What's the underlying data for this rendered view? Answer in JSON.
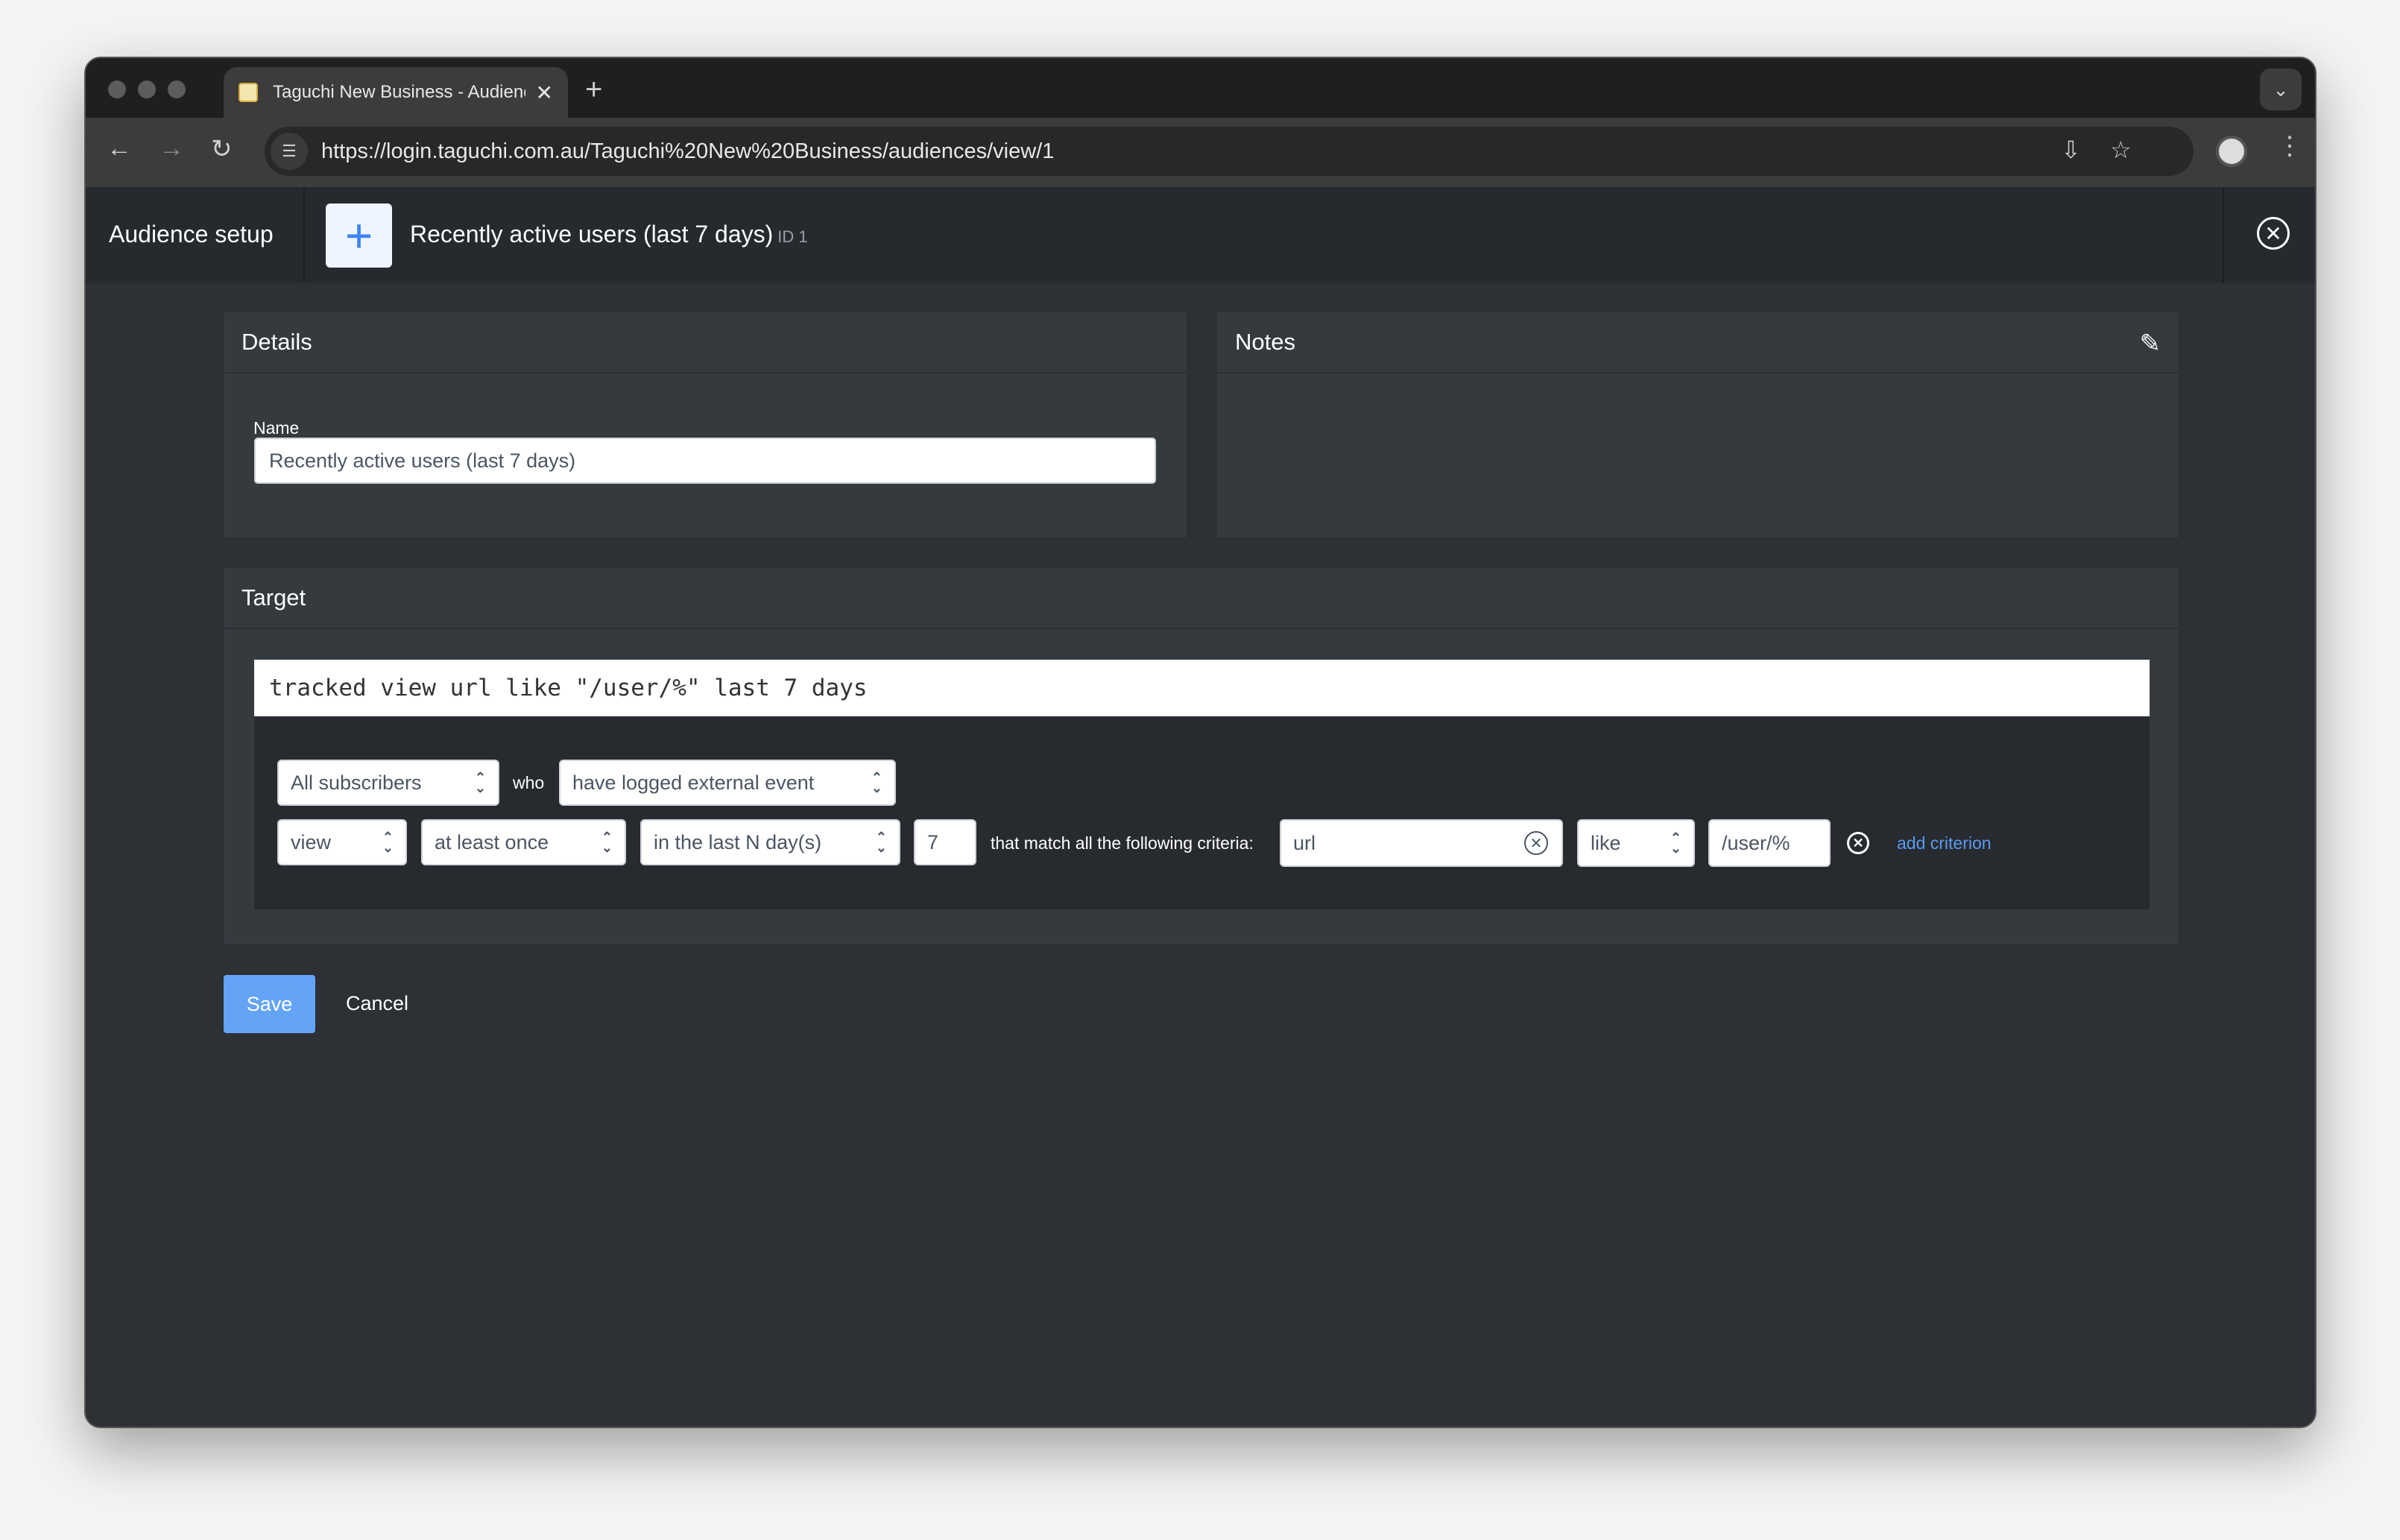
{
  "browser": {
    "tab_title": "Taguchi New Business - Audiences",
    "url": "https://login.taguchi.com.au/Taguchi%20New%20Business/audiences/view/1"
  },
  "header": {
    "section": "Audience setup",
    "title": "Recently active users (last 7 days)",
    "id_label": "ID 1"
  },
  "details": {
    "heading": "Details",
    "name_label": "Name",
    "name_value": "Recently active users (last 7 days)"
  },
  "notes": {
    "heading": "Notes"
  },
  "target": {
    "heading": "Target",
    "expression": "tracked view url like \"/user/%\" last 7 days",
    "subscribers": "All subscribers",
    "who": "who",
    "event_type": "have logged external event",
    "event": "view",
    "frequency": "at least once",
    "period": "in the last N day(s)",
    "days": "7",
    "criteria_text": "that match all the following criteria:",
    "criterion_field": "url",
    "criterion_operator": "like",
    "criterion_value": "/user/%",
    "add_criterion": "add criterion"
  },
  "actions": {
    "save": "Save",
    "cancel": "Cancel"
  },
  "colors": {
    "accent": "#63a4f7",
    "link": "#5a9cf0",
    "panel": "#353a3f",
    "background": "#2d3035"
  }
}
